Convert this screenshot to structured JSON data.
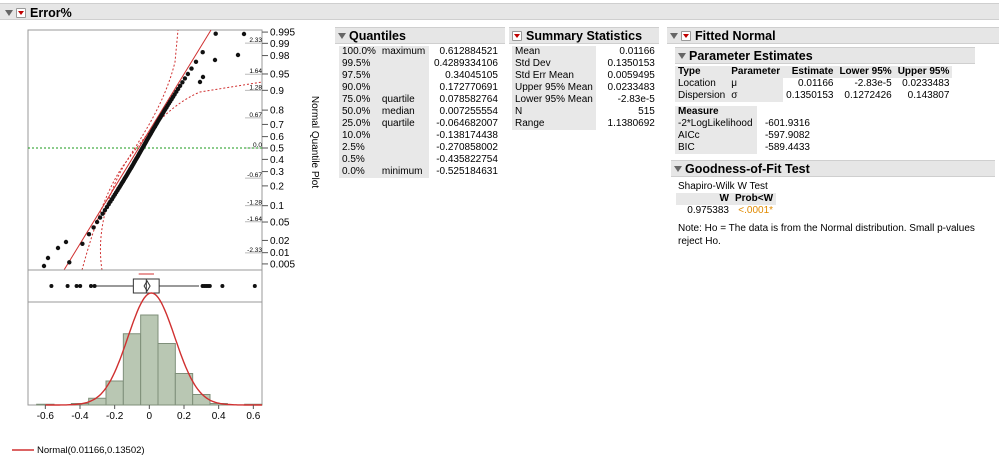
{
  "report": {
    "title": "Error%"
  },
  "quantile_plot": {
    "axis_title": "Normal Quantile Plot",
    "prob_ticks": [
      "0.995",
      "0.99",
      "0.98",
      "0.95",
      "0.9",
      "0.8",
      "0.7",
      "0.6",
      "0.5",
      "0.4",
      "0.3",
      "0.2",
      "0.1",
      "0.05",
      "0.02",
      "0.01",
      "0.005"
    ],
    "z_ticks": [
      "2.33",
      "1.64",
      "1.28",
      "0.67",
      "0.0",
      "-0.67",
      "-1.28",
      "-1.64",
      "-2.33"
    ]
  },
  "histogram": {
    "x_ticks": [
      "-0.6",
      "-0.4",
      "-0.2",
      "0",
      "0.2",
      "0.4",
      "0.6"
    ],
    "legend": "Normal(0.01166,0.13502)"
  },
  "quantiles": {
    "title": "Quantiles",
    "rows": [
      {
        "pct": "100.0%",
        "label": "maximum",
        "value": "0.612884521"
      },
      {
        "pct": "99.5%",
        "label": "",
        "value": "0.4289334106"
      },
      {
        "pct": "97.5%",
        "label": "",
        "value": "0.34045105"
      },
      {
        "pct": "90.0%",
        "label": "",
        "value": "0.172770691"
      },
      {
        "pct": "75.0%",
        "label": "quartile",
        "value": "0.078582764"
      },
      {
        "pct": "50.0%",
        "label": "median",
        "value": "0.007255554"
      },
      {
        "pct": "25.0%",
        "label": "quartile",
        "value": "-0.064682007"
      },
      {
        "pct": "10.0%",
        "label": "",
        "value": "-0.138174438"
      },
      {
        "pct": "2.5%",
        "label": "",
        "value": "-0.270858002"
      },
      {
        "pct": "0.5%",
        "label": "",
        "value": "-0.435822754"
      },
      {
        "pct": "0.0%",
        "label": "minimum",
        "value": "-0.525184631"
      }
    ]
  },
  "summary": {
    "title": "Summary Statistics",
    "rows": [
      {
        "label": "Mean",
        "value": "0.01166"
      },
      {
        "label": "Std Dev",
        "value": "0.1350153"
      },
      {
        "label": "Std Err Mean",
        "value": "0.0059495"
      },
      {
        "label": "Upper 95% Mean",
        "value": "0.0233483"
      },
      {
        "label": "Lower 95% Mean",
        "value": "-2.83e-5"
      },
      {
        "label": "N",
        "value": "515"
      },
      {
        "label": "Range",
        "value": "1.1380692"
      }
    ]
  },
  "fitted": {
    "title": "Fitted Normal",
    "param_title": "Parameter Estimates",
    "headers": [
      "Type",
      "Parameter",
      "Estimate",
      "Lower 95%",
      "Upper 95%"
    ],
    "rows": [
      {
        "type": "Location",
        "param": "μ",
        "estimate": "0.01166",
        "lower": "-2.83e-5",
        "upper": "0.0233483"
      },
      {
        "type": "Dispersion",
        "param": "σ",
        "estimate": "0.1350153",
        "lower": "0.1272426",
        "upper": "0.143807"
      }
    ],
    "measure_header": "Measure",
    "measures": [
      {
        "label": "-2*LogLikelihood",
        "value": "-601.9316"
      },
      {
        "label": "AICc",
        "value": "-597.9082"
      },
      {
        "label": "BIC",
        "value": "-589.4433"
      }
    ],
    "gof_title": "Goodness-of-Fit Test",
    "gof_test": "Shapiro-Wilk W Test",
    "gof_headers": [
      "W",
      "Prob<W"
    ],
    "gof_w": "0.975383",
    "gof_p": "<.0001*",
    "note": "Note: Ho = The data is from the Normal distribution. Small p-values reject Ho."
  },
  "colors": {
    "fit_line": "#d03030",
    "bars": "#b9c7b3",
    "p_value": "#e08a00",
    "reference": "#1a9a1a"
  }
}
